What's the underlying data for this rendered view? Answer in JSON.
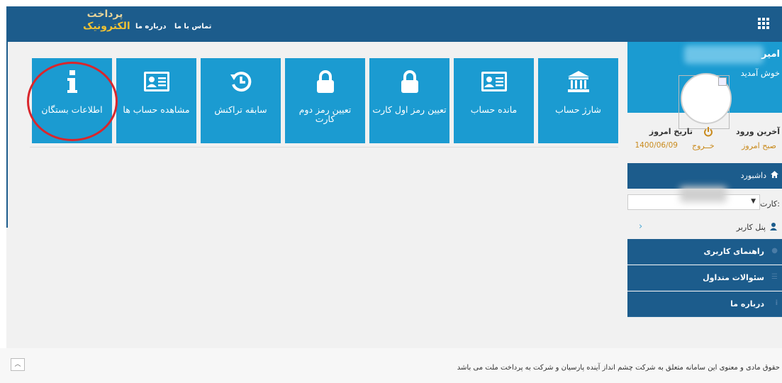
{
  "header": {
    "logo_line1": "پرداخت",
    "logo_line2": "الکترونیک",
    "links": [
      "تماس با ما",
      "درباره ما"
    ]
  },
  "tiles": [
    {
      "label": "شارژ حساب",
      "icon": "bank-icon"
    },
    {
      "label": "مانده حساب",
      "icon": "id-card-icon"
    },
    {
      "label": "تعیین رمز اول کارت",
      "icon": "lock-icon"
    },
    {
      "label": "تعیین رمز دوم کارت",
      "icon": "lock-icon"
    },
    {
      "label": "سابقه تراکنش",
      "icon": "history-icon"
    },
    {
      "label": "مشاهده حساب ها",
      "icon": "id-card-icon"
    },
    {
      "label": "اطلاعات بستگان",
      "icon": "info-icon"
    }
  ],
  "sidebar": {
    "name": "امیر",
    "welcome": "خوش آمدید",
    "last_login_label": "آخرین ورود",
    "last_login_value": "صبح امروز",
    "today_label": "تاریخ امروز",
    "today_value": "1400/06/09",
    "logout_label": "خــروج",
    "dashboard_label": "داشبورد",
    "card_label": "کارت:",
    "user_panel_label": "پنل کاربر",
    "nav_items": [
      "راهنمای کاربری",
      "سئوالات متداول",
      "درباره ما"
    ]
  },
  "footer": {
    "copyright": "حقوق مادی و معنوی این سامانه متعلق به شرکت چشم انداز آینده پارسیان و شرکت به پرداخت ملت می باشد"
  },
  "colors": {
    "topbar": "#1c5c8c",
    "tile": "#1b9bd1",
    "accent_gold": "#c98a1c",
    "annotation_red": "#d9262c"
  }
}
